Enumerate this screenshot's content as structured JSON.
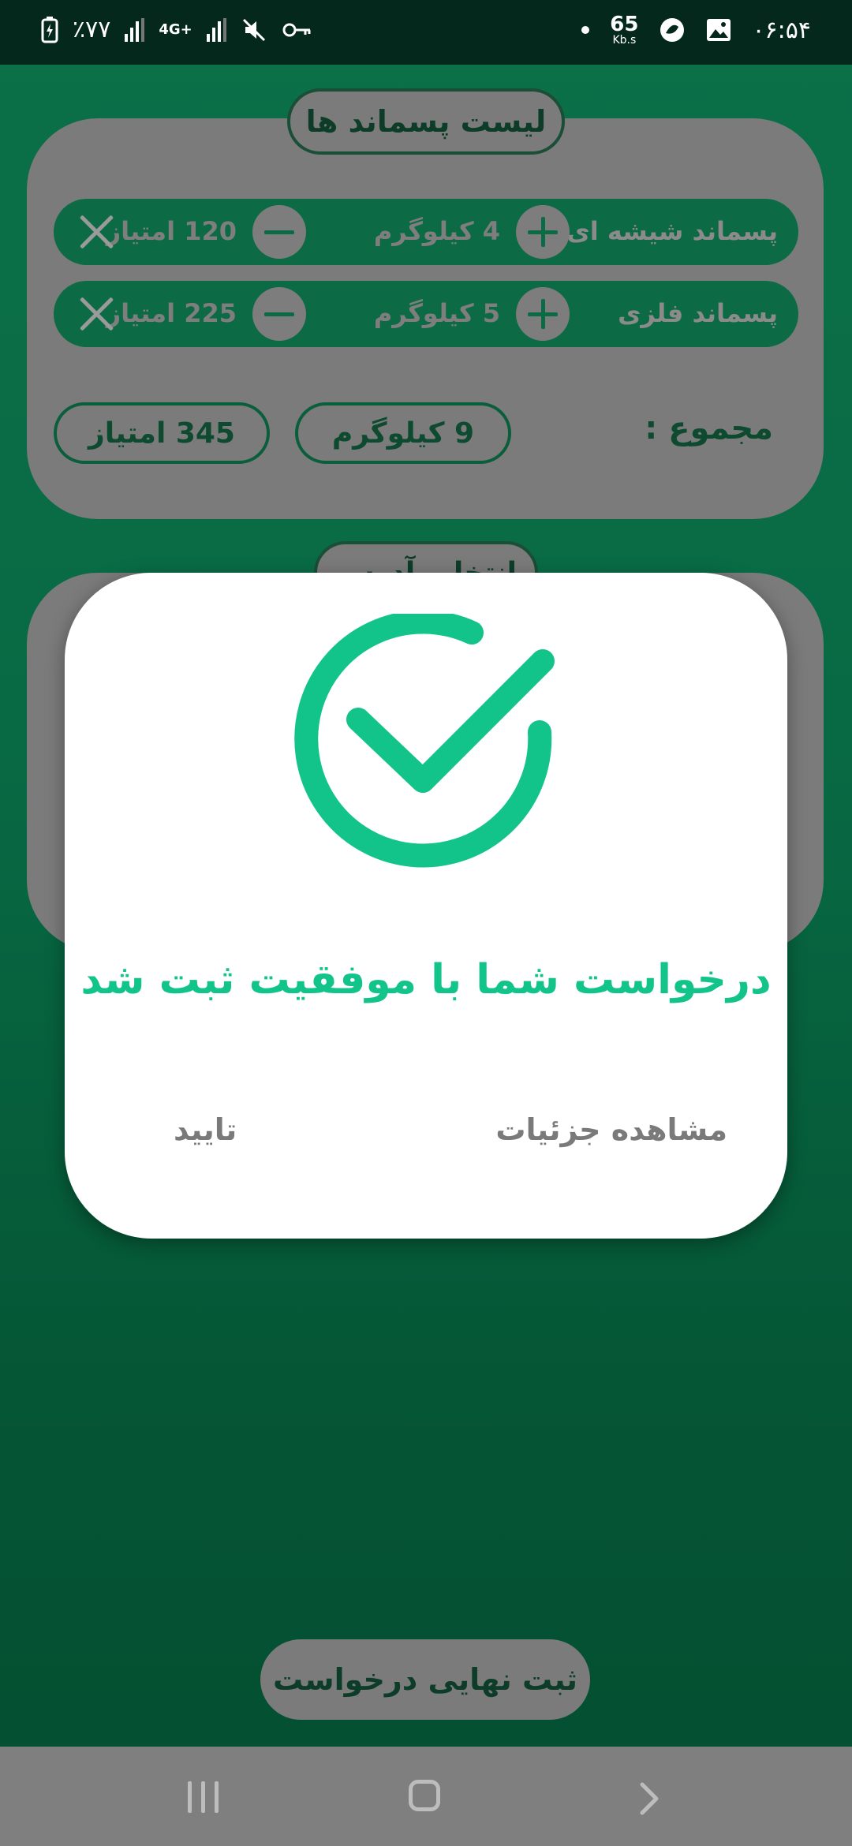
{
  "status_bar": {
    "battery": "٪۷۷",
    "network": "4G+",
    "speed_value": "65",
    "speed_unit": "Kb.s",
    "time": "۰۶:۵۴"
  },
  "waste_list": {
    "title": "لیست پسماند ها",
    "items": [
      {
        "name": "پسماند شیشه ای",
        "weight": "4 کیلوگرم",
        "points": "120 امتیاز"
      },
      {
        "name": "پسماند فلزی",
        "weight": "5 کیلوگرم",
        "points": "225 امتیاز"
      }
    ],
    "total_label": "مجموع :",
    "total_weight": "9 کیلوگرم",
    "total_points": "345 امتیاز"
  },
  "address_section": {
    "title": "انتخاب آدرس"
  },
  "submit_button": "ثبت نهایی درخواست",
  "dialog": {
    "message": "درخواست شما با موفقیت ثبت شد",
    "details_button": "مشاهده جزئیات",
    "ok_button": "تایید"
  },
  "colors": {
    "accent": "#13c48a",
    "background": "#0b7048",
    "overlay_gray": "#7b7b7b"
  },
  "icons": {
    "dialog_icon": "check-circle-icon",
    "remove_icon": "close-icon"
  }
}
